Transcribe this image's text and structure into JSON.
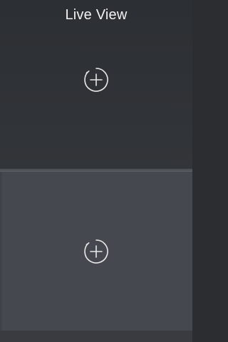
{
  "header": {
    "title": "Live View"
  },
  "slots": [
    {
      "action_icon": "add-camera-icon"
    },
    {
      "action_icon": "add-camera-icon"
    }
  ],
  "colors": {
    "top_pane": "#2f3236",
    "bottom_pane": "#45484e",
    "divider": "#5a5d62",
    "icon": "#e8e8e8"
  }
}
